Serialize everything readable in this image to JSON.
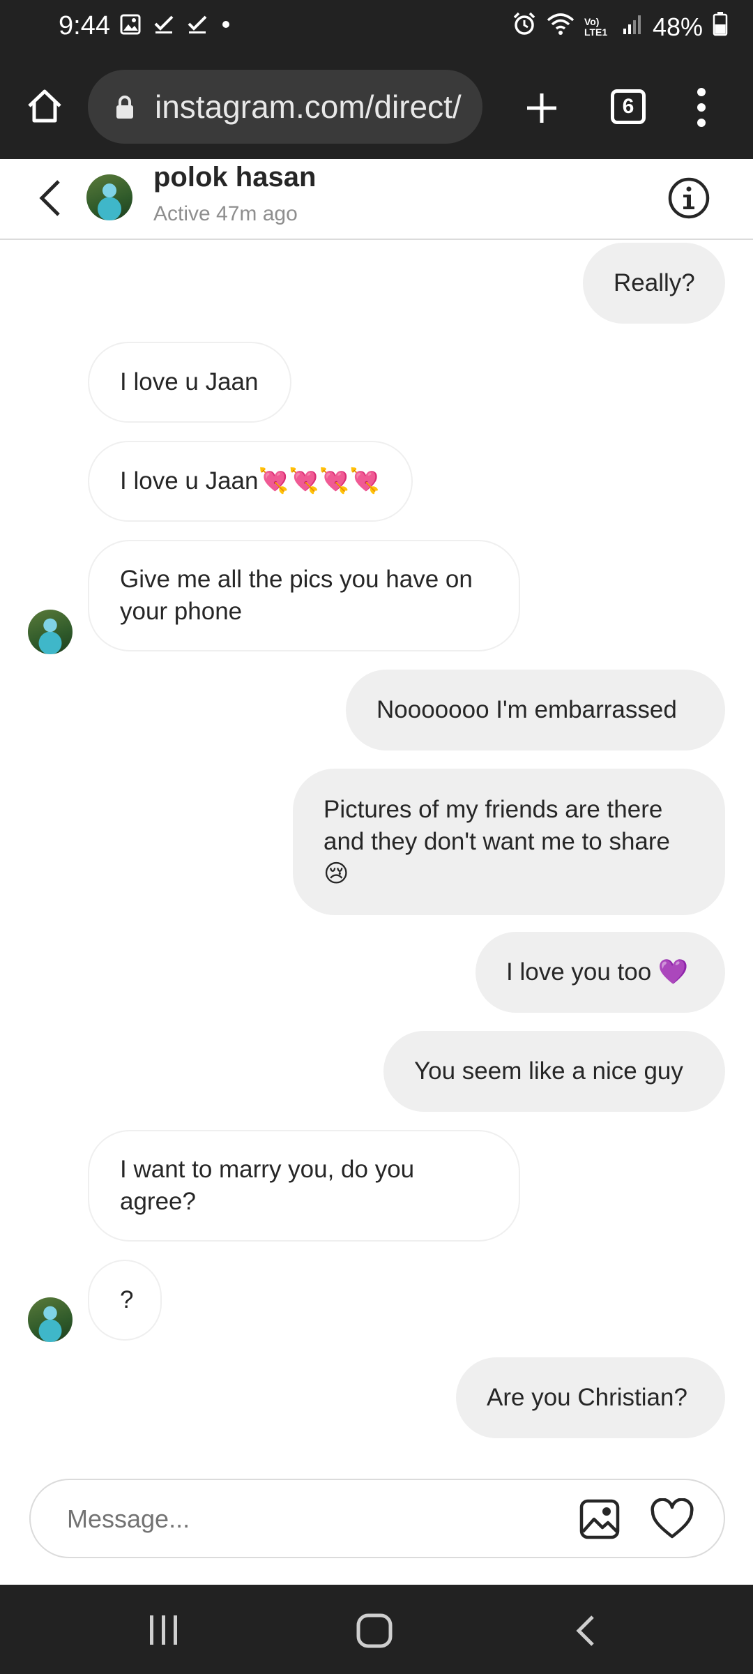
{
  "status_bar": {
    "time": "9:44",
    "battery": "48%",
    "network_label": "Vo) LTE1",
    "icons": [
      "image-icon",
      "check-icon",
      "check-icon",
      "dot-icon",
      "alarm-icon",
      "wifi-icon",
      "signal-icon",
      "battery-icon"
    ]
  },
  "browser": {
    "url": "instagram.com/direct/",
    "tab_count": "6"
  },
  "chat_header": {
    "name": "polok hasan",
    "status": "Active 47m ago"
  },
  "messages": [
    {
      "side": "sent",
      "text": "Really?"
    },
    {
      "side": "recv",
      "text": "I love u Jaan"
    },
    {
      "side": "recv",
      "text": "I love u Jaan💘💘💘💘"
    },
    {
      "side": "recv",
      "text": "Give me all the pics you have on your phone"
    },
    {
      "side": "sent",
      "text": "Nooooooo I'm embarrassed"
    },
    {
      "side": "sent",
      "text": "Pictures of my friends are there and they don't want me to share 😢"
    },
    {
      "side": "sent",
      "text": "I love you too 💜"
    },
    {
      "side": "sent",
      "text": "You seem like a nice guy"
    },
    {
      "side": "recv",
      "text": "I want to marry you, do you agree?"
    },
    {
      "side": "recv",
      "text": "?"
    },
    {
      "side": "sent",
      "text": "Are you Christian?"
    }
  ],
  "composer": {
    "placeholder": "Message..."
  },
  "colors": {
    "system_bar": "#222222",
    "sent_bubble": "#efefef",
    "received_border": "#efefef",
    "text": "#262626",
    "muted": "#8e8e8e"
  }
}
